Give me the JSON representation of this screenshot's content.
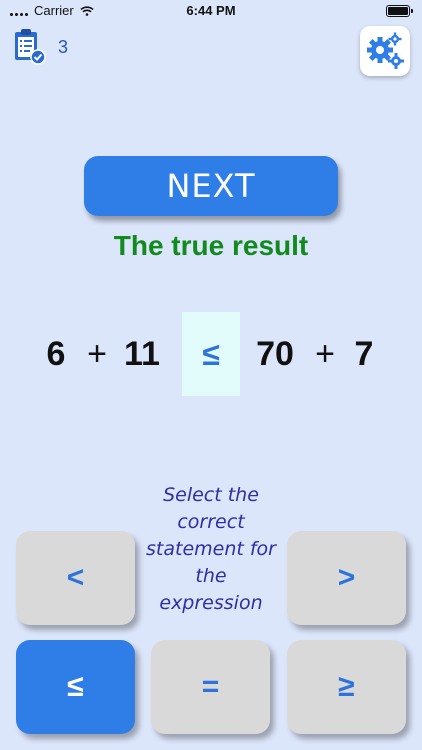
{
  "status_bar": {
    "carrier": "Carrier",
    "time": "6:44 PM"
  },
  "score": {
    "value": "3",
    "icon": "clipboard-check-icon"
  },
  "settings": {
    "icon": "gears-icon"
  },
  "next_button": {
    "label": "NEXT"
  },
  "result_text": "The true result",
  "expression": {
    "left_a": "6",
    "left_op": "+",
    "left_b": "11",
    "comparator": "≤",
    "right_a": "70",
    "right_op": "+",
    "right_b": "7"
  },
  "instruction": "Select the correct statement for the expression",
  "buttons": {
    "less": "<",
    "greater": ">",
    "less_equal": "≤",
    "equal": "=",
    "greater_equal": "≥"
  },
  "selected_button": "less_equal",
  "colors": {
    "background": "#dce6fb",
    "accent": "#2f7ee8",
    "result_green": "#128a1e",
    "instruction_text": "#2d2fa6",
    "comparator_highlight": "#e2fcfc"
  }
}
